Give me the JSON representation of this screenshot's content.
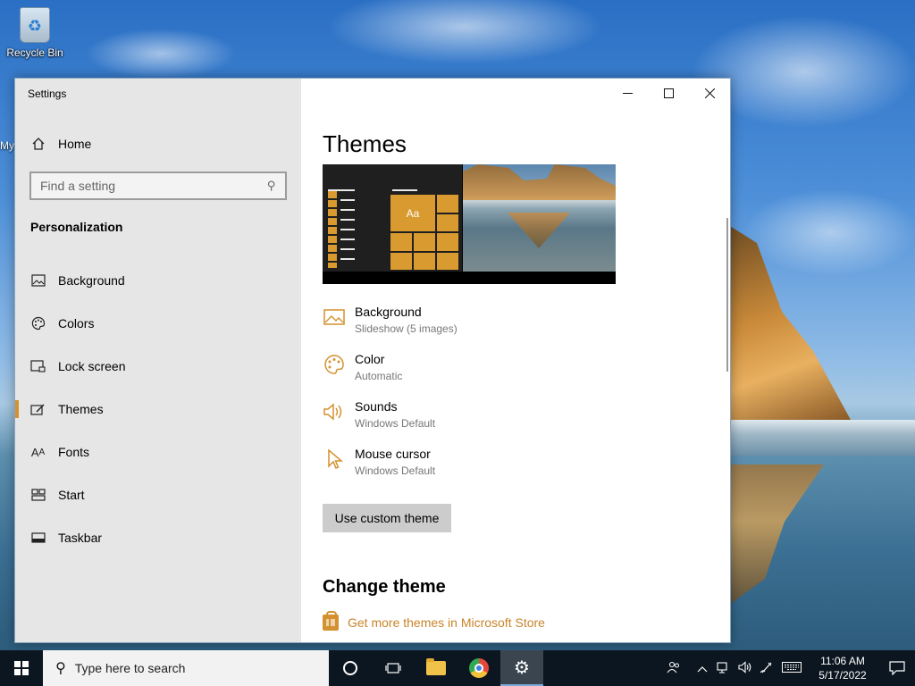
{
  "desktop": {
    "recycle_bin_label": "Recycle Bin",
    "partial_icon_label": "My"
  },
  "window": {
    "title": "Settings",
    "caption": {
      "minimize": "—",
      "maximize": "☐",
      "close": "✕"
    }
  },
  "sidebar": {
    "home_label": "Home",
    "search_placeholder": "Find a setting",
    "section_title": "Personalization",
    "items": [
      {
        "label": "Background",
        "icon": "picture-icon"
      },
      {
        "label": "Colors",
        "icon": "palette-icon"
      },
      {
        "label": "Lock screen",
        "icon": "lock-screen-icon"
      },
      {
        "label": "Themes",
        "icon": "themes-icon",
        "active": true
      },
      {
        "label": "Fonts",
        "icon": "fonts-icon"
      },
      {
        "label": "Start",
        "icon": "start-icon"
      },
      {
        "label": "Taskbar",
        "icon": "taskbar-icon"
      }
    ]
  },
  "main": {
    "title": "Themes",
    "preview_tile_text": "Aa",
    "properties": [
      {
        "name": "Background",
        "value": "Slideshow (5 images)",
        "icon": "picture-icon"
      },
      {
        "name": "Color",
        "value": "Automatic",
        "icon": "palette-icon"
      },
      {
        "name": "Sounds",
        "value": "Windows Default",
        "icon": "speaker-icon"
      },
      {
        "name": "Mouse cursor",
        "value": "Windows Default",
        "icon": "cursor-icon"
      }
    ],
    "custom_theme_button": "Use custom theme",
    "change_theme_title": "Change theme",
    "store_link": "Get more themes in Microsoft Store"
  },
  "taskbar": {
    "search_placeholder": "Type here to search",
    "time": "11:06 AM",
    "date": "5/17/2022"
  },
  "colors": {
    "accent": "#d4912f",
    "taskbar": "#0c1620",
    "sidebar": "#e6e6e6"
  }
}
